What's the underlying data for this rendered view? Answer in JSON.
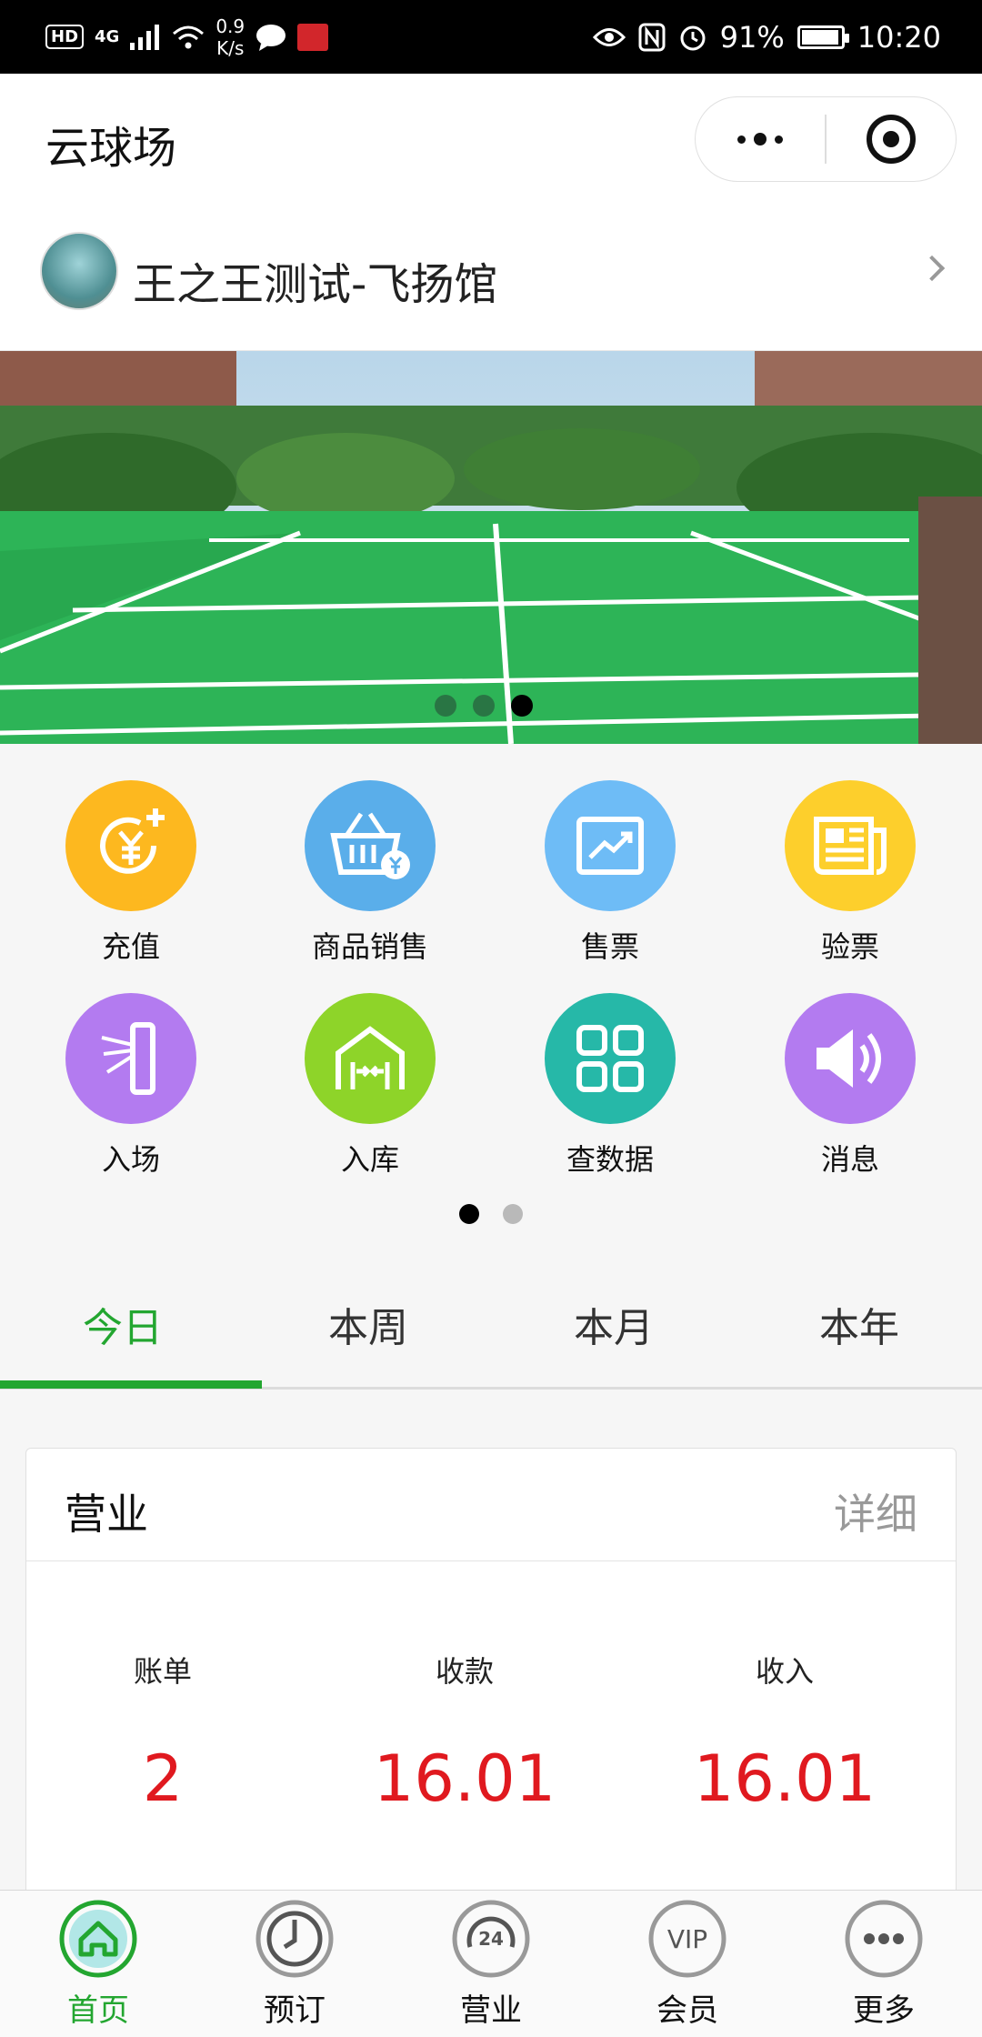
{
  "status_bar": {
    "hd": "HD",
    "network": "4G",
    "speed": "0.9\nK/s",
    "speed_top": "0.9",
    "speed_bottom": "K/s",
    "battery": "91%",
    "time": "10:20",
    "battery_level": 0.91
  },
  "nav": {
    "title": "云球场",
    "more_icon": "more-dots-icon",
    "close_icon": "target-icon"
  },
  "venue": {
    "name": "王之王测试-飞扬馆",
    "arrow_icon": "chevron-right-icon"
  },
  "banner": {
    "slides": 3,
    "active_slide": 3
  },
  "grid": {
    "items": [
      {
        "label": "充值",
        "icon": "recharge-icon",
        "color": "#fdb81f"
      },
      {
        "label": "商品销售",
        "icon": "basket-icon",
        "color": "#5aaeea"
      },
      {
        "label": "售票",
        "icon": "chart-icon",
        "color": "#6ebcf6"
      },
      {
        "label": "验票",
        "icon": "newspaper-icon",
        "color": "#fdcf2c"
      },
      {
        "label": "入场",
        "icon": "gate-icon",
        "color": "#b37bf0"
      },
      {
        "label": "入库",
        "icon": "warehouse-icon",
        "color": "#8ed429"
      },
      {
        "label": "查数据",
        "icon": "grid-data-icon",
        "color": "#26b8a8"
      },
      {
        "label": "消息",
        "icon": "speaker-icon",
        "color": "#b37bf0"
      }
    ],
    "pages": 2,
    "active_page": 1
  },
  "tabs": [
    {
      "label": "今日",
      "active": true
    },
    {
      "label": "本周",
      "active": false
    },
    {
      "label": "本月",
      "active": false
    },
    {
      "label": "本年",
      "active": false
    }
  ],
  "card": {
    "title": "营业",
    "detail": "详细",
    "stats": [
      {
        "label": "账单",
        "value": "2"
      },
      {
        "label": "收款",
        "value": "16.01"
      },
      {
        "label": "收入",
        "value": "16.01"
      }
    ]
  },
  "tabbar": [
    {
      "label": "首页",
      "icon": "home-icon",
      "active": true
    },
    {
      "label": "预订",
      "icon": "clock-icon",
      "active": false
    },
    {
      "label": "营业",
      "icon": "24h-icon",
      "active": false
    },
    {
      "label": "会员",
      "icon": "vip-icon",
      "active": false
    },
    {
      "label": "更多",
      "icon": "more-icon",
      "active": false
    }
  ],
  "colors": {
    "accent": "#23a630",
    "value_red": "#e0191f"
  }
}
